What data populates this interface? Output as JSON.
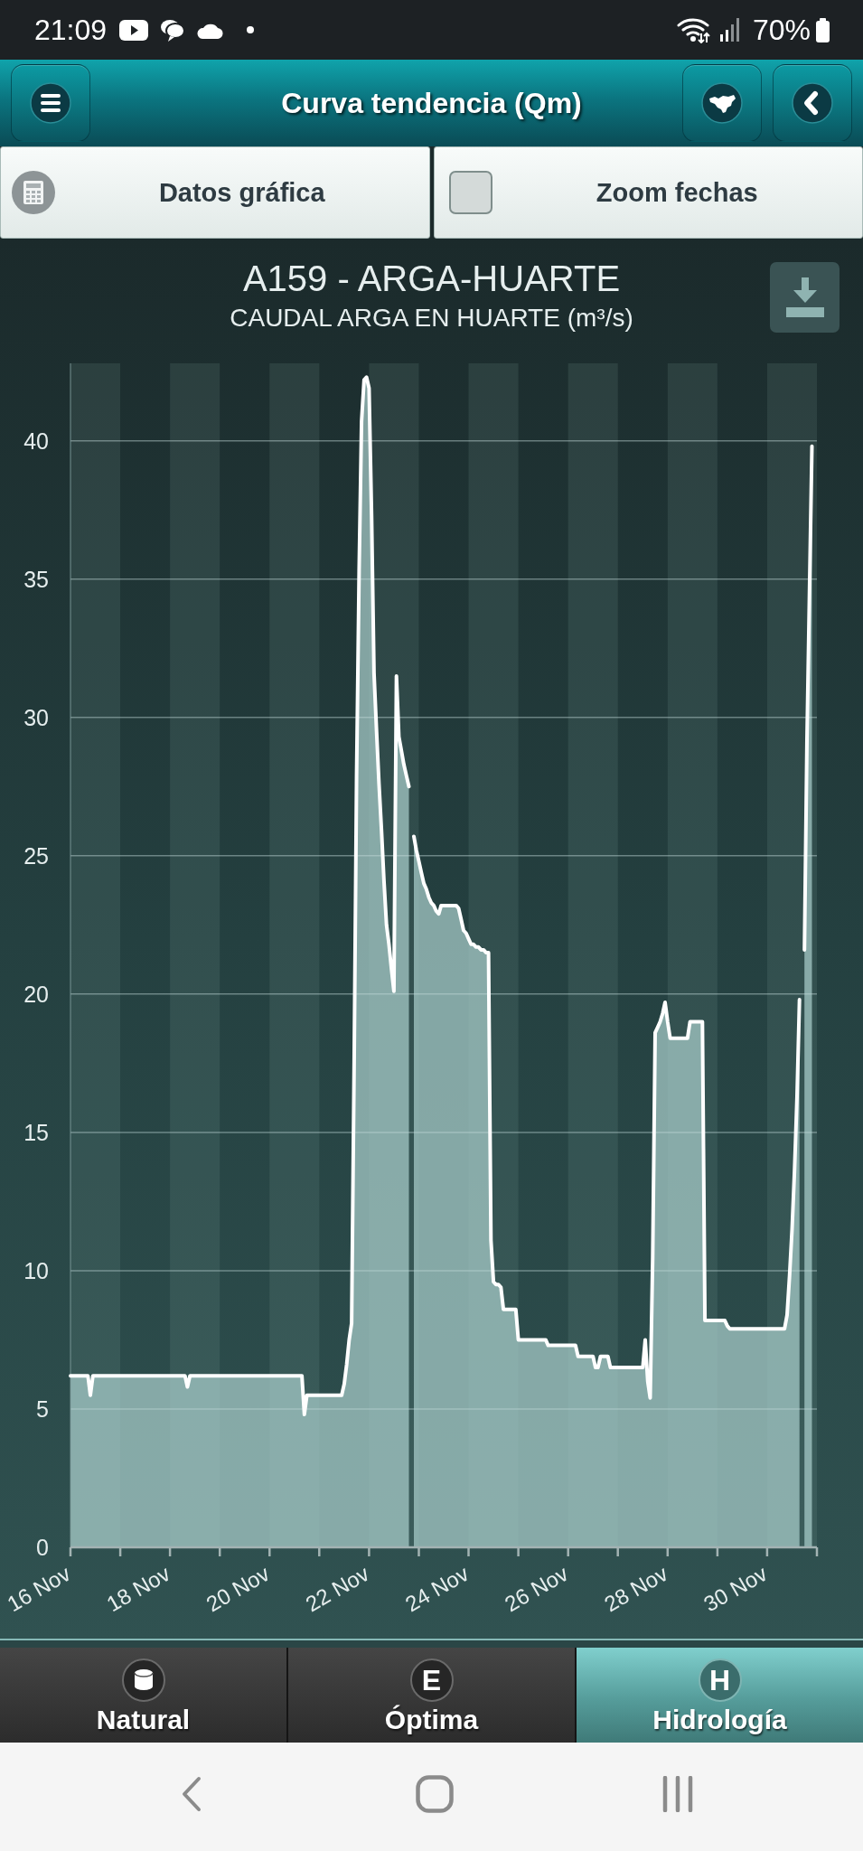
{
  "status_bar": {
    "time": "21:09",
    "battery": "70%"
  },
  "header": {
    "title": "Curva tendencia (Qm)"
  },
  "toolbar": [
    {
      "kind": "button",
      "label": "Datos gráfica"
    },
    {
      "kind": "checkbox",
      "label": "Zoom fechas",
      "checked": false
    }
  ],
  "chart": {
    "title": "A159 - ARGA-HUARTE",
    "subtitle": "CAUDAL ARGA EN HUARTE (m³/s)",
    "chart_data": {
      "type": "area",
      "grid": true,
      "categories": [
        "16 Nov",
        null,
        null,
        null,
        null,
        null,
        null,
        null,
        null,
        null,
        null,
        null,
        null,
        null,
        null,
        null,
        null,
        null,
        null,
        null,
        null,
        null,
        null,
        null,
        null,
        null,
        null,
        null,
        null,
        null,
        null,
        null,
        null,
        null,
        null,
        null,
        null,
        null,
        null,
        null,
        "18 Nov",
        null,
        null,
        null,
        null,
        null,
        null,
        null,
        null,
        null,
        null,
        null,
        null,
        null,
        null,
        null,
        null,
        null,
        null,
        null,
        null,
        null,
        null,
        null,
        null,
        null,
        null,
        null,
        null,
        null,
        null,
        null,
        null,
        null,
        null,
        null,
        null,
        null,
        null,
        null,
        "20 Nov",
        null,
        null,
        null,
        null,
        null,
        null,
        null,
        null,
        null,
        null,
        null,
        null,
        null,
        null,
        null,
        null,
        null,
        null,
        null,
        null,
        null,
        null,
        null,
        null,
        null,
        null,
        null,
        null,
        null,
        null,
        null,
        null,
        null,
        null,
        null,
        null,
        null,
        null,
        null,
        "22 Nov",
        null,
        null,
        null,
        null,
        null,
        null,
        null,
        null,
        null,
        null,
        null,
        null,
        null,
        null,
        null,
        null,
        null,
        null,
        null,
        null,
        null,
        null,
        null,
        null,
        null,
        null,
        null,
        null,
        null,
        null,
        null,
        null,
        null,
        null,
        null,
        null,
        null,
        null,
        null,
        "24 Nov",
        null,
        null,
        null,
        null,
        null,
        null,
        null,
        null,
        null,
        null,
        null,
        null,
        null,
        null,
        null,
        null,
        null,
        null,
        null,
        null,
        null,
        null,
        null,
        null,
        null,
        null,
        null,
        null,
        null,
        null,
        null,
        null,
        null,
        null,
        null,
        null,
        null,
        null,
        null,
        "26 Nov",
        null,
        null,
        null,
        null,
        null,
        null,
        null,
        null,
        null,
        null,
        null,
        null,
        null,
        null,
        null,
        null,
        null,
        null,
        null,
        null,
        null,
        null,
        null,
        null,
        null,
        null,
        null,
        null,
        null,
        null,
        null,
        null,
        null,
        null,
        null,
        null,
        null,
        null,
        null,
        "28 Nov",
        null,
        null,
        null,
        null,
        null,
        null,
        null,
        null,
        null,
        null,
        null,
        null,
        null,
        null,
        null,
        null,
        null,
        null,
        null,
        null,
        null,
        null,
        null,
        null,
        null,
        null,
        null,
        null,
        null,
        null,
        null,
        null,
        null,
        null,
        null,
        null,
        null,
        null,
        null,
        "30 Nov",
        null,
        null,
        null,
        null,
        null,
        null,
        null,
        null,
        null,
        null,
        null,
        null,
        null,
        null,
        null,
        null,
        null,
        null,
        null,
        null
      ],
      "values": [
        6.2,
        6.2,
        6.2,
        6.2,
        6.2,
        6.2,
        6.2,
        6.2,
        5.5,
        6.2,
        6.2,
        6.2,
        6.2,
        6.2,
        6.2,
        6.2,
        6.2,
        6.2,
        6.2,
        6.2,
        6.2,
        6.2,
        6.2,
        6.2,
        6.2,
        6.2,
        6.2,
        6.2,
        6.2,
        6.2,
        6.2,
        6.2,
        6.2,
        6.2,
        6.2,
        6.2,
        6.2,
        6.2,
        6.2,
        6.2,
        6.2,
        6.2,
        6.2,
        6.2,
        6.2,
        6.2,
        6.2,
        5.8,
        6.2,
        6.2,
        6.2,
        6.2,
        6.2,
        6.2,
        6.2,
        6.2,
        6.2,
        6.2,
        6.2,
        6.2,
        6.2,
        6.2,
        6.2,
        6.2,
        6.2,
        6.2,
        6.2,
        6.2,
        6.2,
        6.2,
        6.2,
        6.2,
        6.2,
        6.2,
        6.2,
        6.2,
        6.2,
        6.2,
        6.2,
        6.2,
        6.2,
        6.2,
        6.2,
        6.2,
        6.2,
        6.2,
        6.2,
        6.2,
        6.2,
        6.2,
        6.2,
        6.2,
        6.2,
        6.2,
        4.8,
        5.5,
        5.5,
        5.5,
        5.5,
        5.5,
        5.5,
        5.5,
        5.5,
        5.5,
        5.5,
        5.5,
        5.5,
        5.5,
        5.5,
        5.5,
        5.9,
        6.6,
        7.5,
        8.1,
        17.5,
        27.9,
        35.3,
        40.7,
        42.2,
        42.3,
        41.9,
        37.3,
        31.6,
        29.5,
        27.6,
        25.9,
        24.1,
        22.5,
        21.8,
        20.9,
        20.1,
        31.5,
        29.3,
        28.8,
        28.3,
        27.9,
        27.5,
        null,
        25.7,
        25.2,
        24.8,
        24.4,
        24.0,
        23.8,
        23.5,
        23.3,
        23.2,
        23.0,
        22.9,
        23.2,
        23.2,
        23.2,
        23.2,
        23.2,
        23.2,
        23.2,
        23.1,
        22.7,
        22.3,
        22.2,
        22.0,
        21.8,
        21.8,
        21.7,
        21.7,
        21.6,
        21.6,
        21.5,
        21.5,
        11.1,
        9.6,
        9.5,
        9.5,
        9.4,
        8.6,
        8.6,
        8.6,
        8.6,
        8.6,
        8.6,
        7.5,
        7.5,
        7.5,
        7.5,
        7.5,
        7.5,
        7.5,
        7.5,
        7.5,
        7.5,
        7.5,
        7.5,
        7.3,
        7.3,
        7.3,
        7.3,
        7.3,
        7.3,
        7.3,
        7.3,
        7.3,
        7.3,
        7.3,
        7.3,
        6.9,
        6.9,
        6.9,
        6.9,
        6.9,
        6.9,
        6.9,
        6.5,
        6.5,
        6.9,
        6.9,
        6.9,
        6.9,
        6.5,
        6.5,
        6.5,
        6.5,
        6.5,
        6.5,
        6.5,
        6.5,
        6.5,
        6.5,
        6.5,
        6.5,
        6.5,
        6.5,
        7.5,
        6.0,
        5.4,
        10.5,
        18.6,
        18.8,
        19.0,
        19.3,
        19.7,
        19.0,
        18.4,
        18.4,
        18.4,
        18.4,
        18.4,
        18.4,
        18.4,
        18.4,
        19.0,
        19.0,
        19.0,
        19.0,
        19.0,
        19.0,
        8.2,
        8.2,
        8.2,
        8.2,
        8.2,
        8.2,
        8.2,
        8.2,
        8.2,
        8.0,
        7.9,
        7.9,
        7.9,
        7.9,
        7.9,
        7.9,
        7.9,
        7.9,
        7.9,
        7.9,
        7.9,
        7.9,
        7.9,
        7.9,
        7.9,
        7.9,
        7.9,
        7.9,
        7.9,
        7.9,
        7.9,
        7.9,
        7.9,
        8.4,
        9.8,
        11.5,
        13.6,
        16.3,
        19.8,
        null,
        21.6,
        29.2,
        34.4,
        39.8,
        null,
        null
      ],
      "ylim": [
        0,
        42.8
      ],
      "yticks": [
        0,
        5,
        10,
        15,
        20,
        25,
        30,
        35,
        40
      ]
    }
  },
  "tabs": [
    {
      "kind": "icon",
      "label": "Natural",
      "selected": false
    },
    {
      "kind": "letter",
      "badge": "E",
      "label": "Óptima",
      "selected": false
    },
    {
      "kind": "letter",
      "badge": "H",
      "label": "Hidrología",
      "selected": true
    }
  ]
}
